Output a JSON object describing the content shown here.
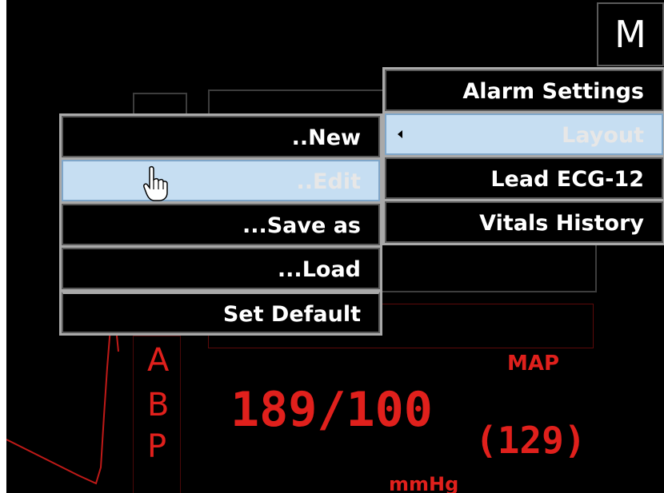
{
  "mode_button": {
    "label": "M"
  },
  "main_menu": {
    "items": [
      {
        "label": "Alarm Settings",
        "highlighted": false
      },
      {
        "label": "Layout",
        "highlighted": true,
        "has_submenu": true
      },
      {
        "label": "Lead ECG-12",
        "highlighted": false
      },
      {
        "label": "Vitals History",
        "highlighted": false
      }
    ]
  },
  "layout_submenu": {
    "items": [
      {
        "label": "..New",
        "highlighted": false
      },
      {
        "label": "..Edit",
        "highlighted": true
      },
      {
        "label": "...Save as",
        "highlighted": false
      },
      {
        "label": "...Load",
        "highlighted": false
      },
      {
        "label": "Set Default",
        "highlighted": false
      }
    ]
  },
  "abp": {
    "letters": [
      "A",
      "B",
      "P"
    ],
    "value": "189/100",
    "map_label": "MAP",
    "map_value": "(129)",
    "unit": "mmHg"
  },
  "colors": {
    "background": "#000000",
    "menu_border": "#a9a9a9",
    "highlight": "#c6def2",
    "vital_red": "#e0201c"
  },
  "icons": {
    "cursor": "hand-pointer-icon",
    "submenu_caret": "caret-left-icon"
  }
}
